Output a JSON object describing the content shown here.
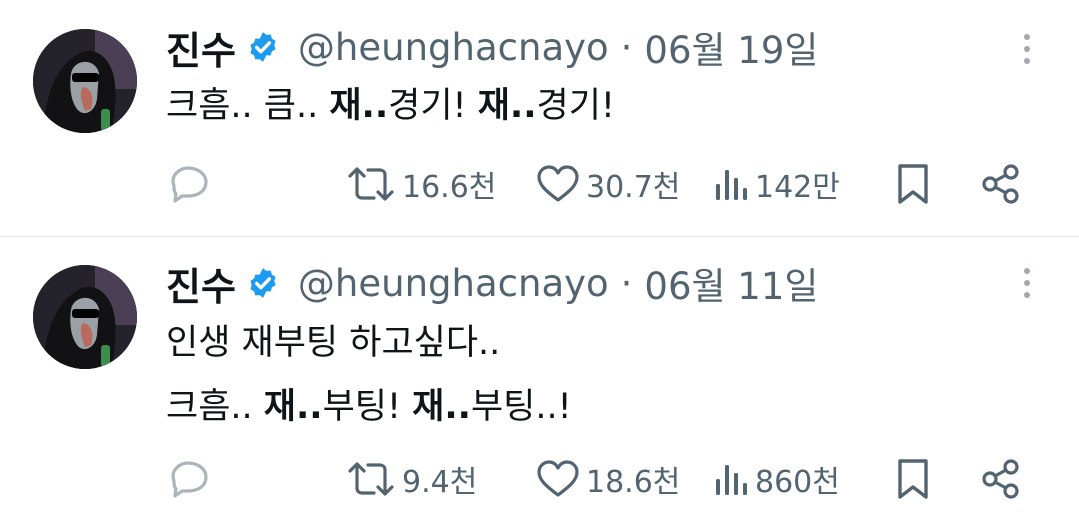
{
  "tweets": [
    {
      "author": "진수",
      "handle": "@heunghacnayo",
      "separator": "·",
      "date": "06월 19일",
      "lines": [
        [
          {
            "text": "크흠.. 큼.. ",
            "bold": false
          },
          {
            "text": "재..",
            "bold": true
          },
          {
            "text": "경기! ",
            "bold": false
          },
          {
            "text": "재..",
            "bold": true
          },
          {
            "text": "경기!",
            "bold": false
          }
        ]
      ],
      "retweets": "16.6천",
      "likes": "30.7천",
      "views": "142만"
    },
    {
      "author": "진수",
      "handle": "@heunghacnayo",
      "separator": "·",
      "date": "06월 11일",
      "lines": [
        [
          {
            "text": "인생 재부팅 하고싶다..",
            "bold": false
          }
        ],
        [
          {
            "text": "크흠.. ",
            "bold": false
          },
          {
            "text": "재..",
            "bold": true
          },
          {
            "text": "부팅! ",
            "bold": false
          },
          {
            "text": "재..",
            "bold": true
          },
          {
            "text": "부팅..!",
            "bold": false
          }
        ]
      ],
      "retweets": "9.4천",
      "likes": "18.6천",
      "views": "860천"
    }
  ],
  "icons": {
    "verified": "verified-badge-icon",
    "more": "more-vertical-icon",
    "reply": "reply-icon",
    "retweet": "retweet-icon",
    "like": "heart-icon",
    "views": "views-icon",
    "bookmark": "bookmark-icon",
    "share": "share-icon"
  },
  "colors": {
    "text": "#0f1419",
    "secondary": "#536471",
    "verified": "#1d9bf0",
    "divider": "#e6e9eb"
  }
}
